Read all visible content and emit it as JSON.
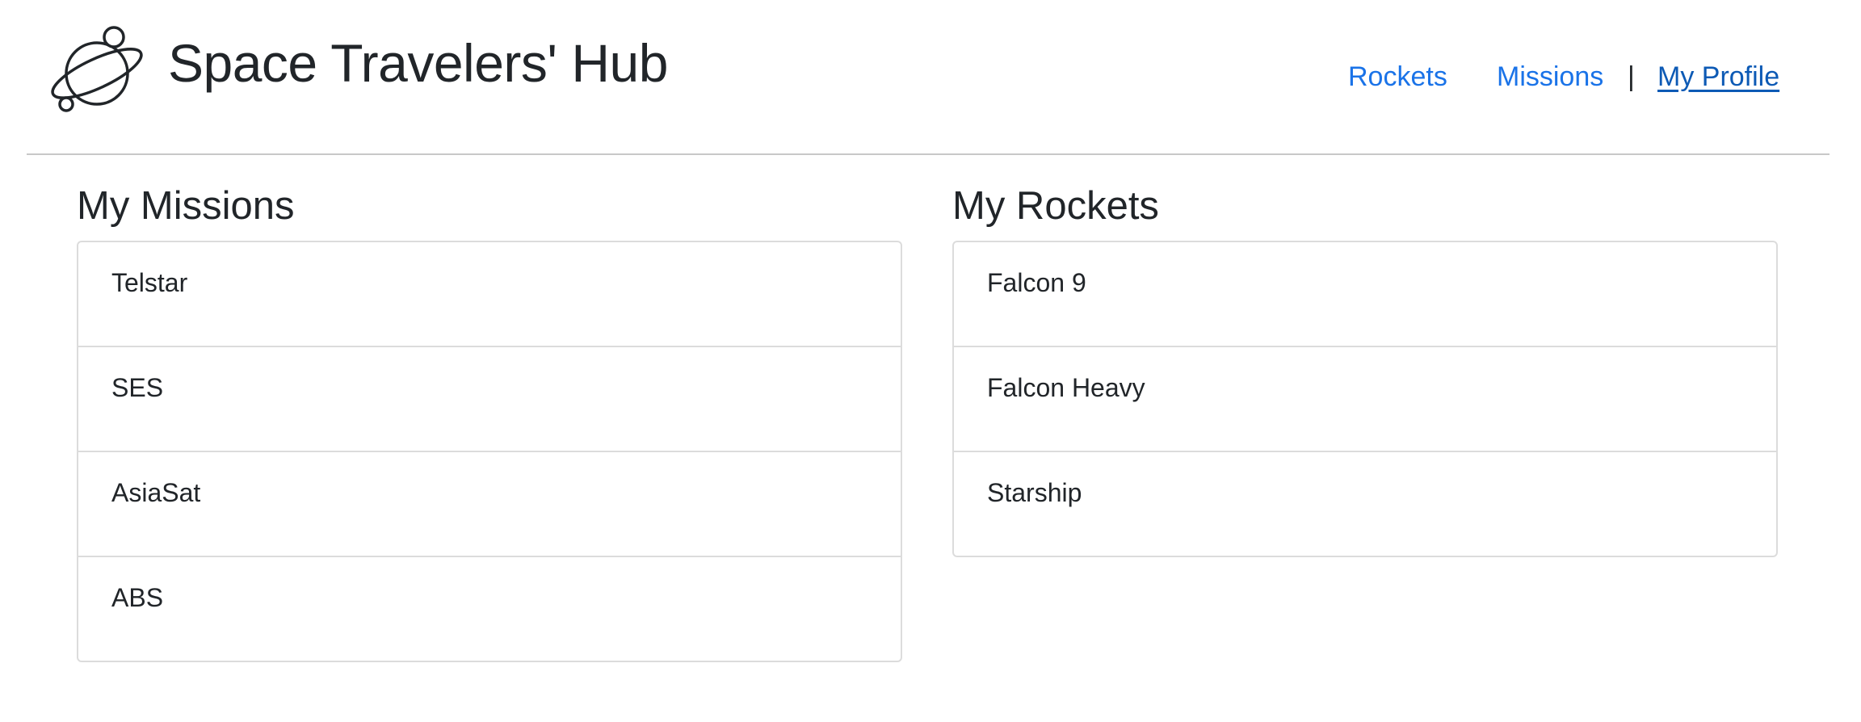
{
  "header": {
    "logo_icon": "planet-icon",
    "title": "Space Travelers' Hub",
    "nav": {
      "rockets": "Rockets",
      "missions": "Missions",
      "separator": "|",
      "profile": "My Profile"
    }
  },
  "missions": {
    "title": "My Missions",
    "items": [
      "Telstar",
      "SES",
      "AsiaSat",
      "ABS"
    ]
  },
  "rockets": {
    "title": "My Rockets",
    "items": [
      "Falcon 9",
      "Falcon Heavy",
      "Starship"
    ]
  },
  "colors": {
    "link": "#1a73e8",
    "active_link": "#0d5ab5",
    "text": "#212529",
    "border": "#dcdcdc"
  }
}
